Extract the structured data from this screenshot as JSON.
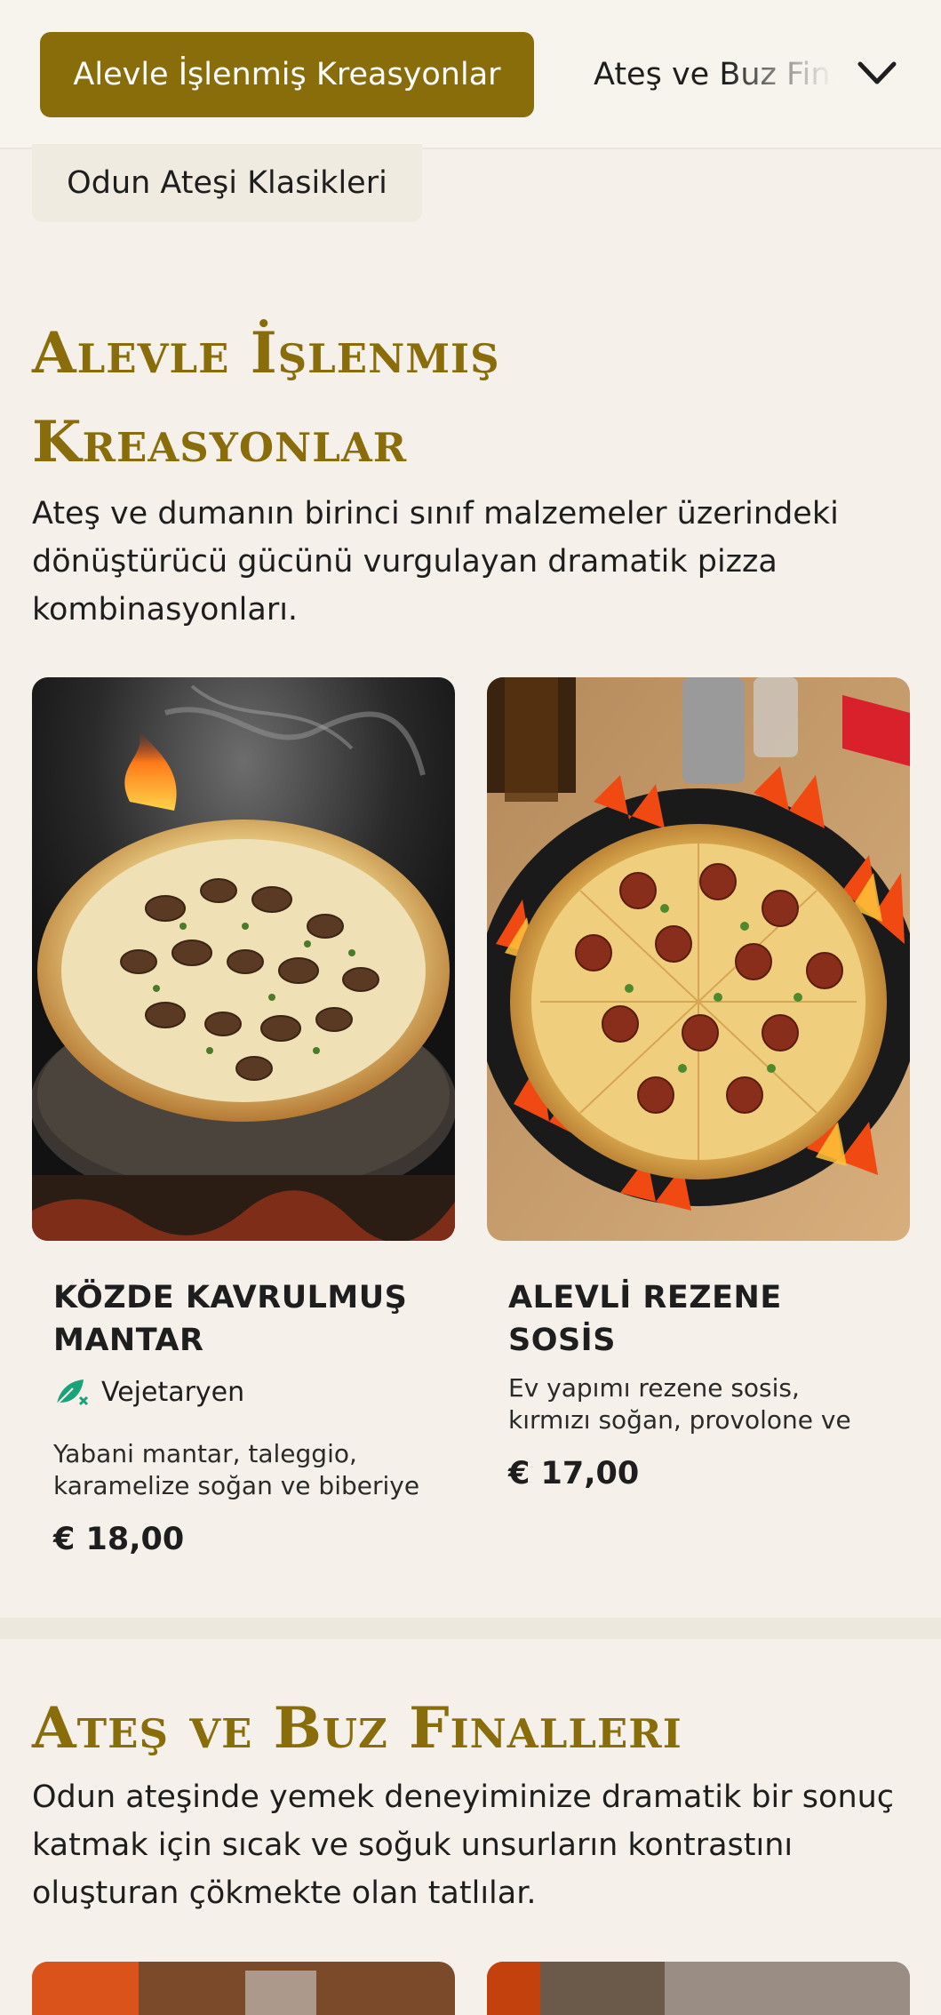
{
  "category_nav": {
    "active_label": "Alevle İşlenmiş Kreasyonlar",
    "next_label": "Ateş ve Buz Finalleri",
    "second_row_label": "Odun Ateşi Klasikleri"
  },
  "sections": [
    {
      "title": "Alevle İşlenmiş Kreasyonlar",
      "description": "Ateş ve dumanın birinci sınıf malzemeler üzerindeki dönüştürücü gücünü vurgulayan dramatik pizza kombinasyonları.",
      "items": [
        {
          "name": "KÖZDE KAVRULMUŞ MANTAR",
          "badge": "Vejetaryen",
          "description": "Yabani mantar, taleggio, karamelize soğan ve biberiye",
          "price": "€ 18,00"
        },
        {
          "name": "ALEVLİ REZENE SOSİS",
          "description": "Ev yapımı rezene sosis, kırmızı soğan, provolone ve",
          "price": "€ 17,00"
        }
      ]
    },
    {
      "title": "Ateş ve Buz Finalleri",
      "description": "Odun ateşinde yemek deneyiminize dramatik bir sonuç katmak için sıcak ve soğuk unsurların kontrastını oluşturan çökmekte olan tatlılar."
    }
  ],
  "icons": {
    "dropdown": "chevron-down-icon",
    "vegetarian": "leaf-icon"
  },
  "colors": {
    "accent": "#8a6d0b",
    "background": "#f5f1ea",
    "veg_icon": "#1aa37a"
  }
}
